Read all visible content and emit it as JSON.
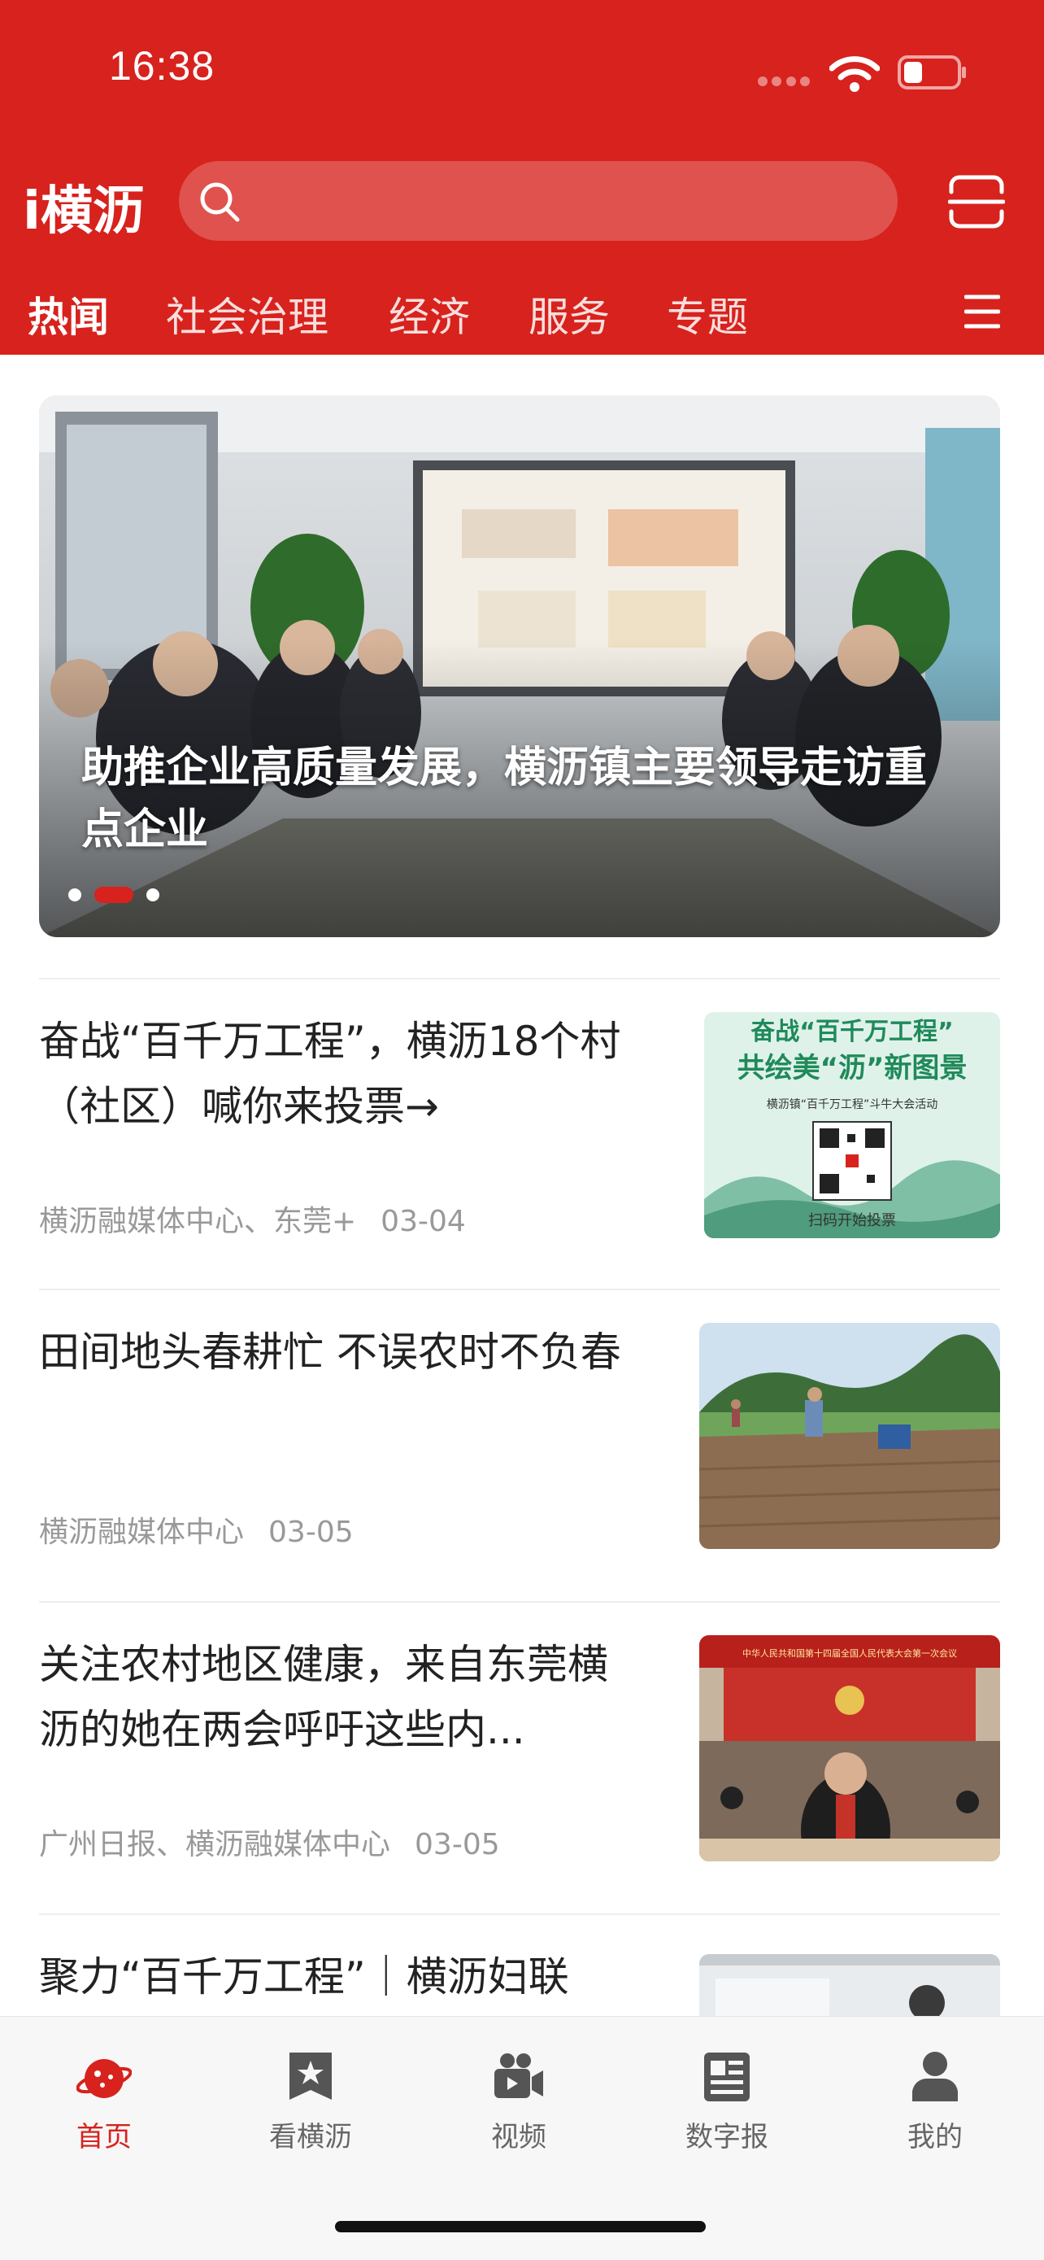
{
  "status_bar": {
    "time": "16:38"
  },
  "header": {
    "logo": "i横沥",
    "search": {
      "placeholder": ""
    },
    "tabs": [
      {
        "label": "热闻",
        "active": true
      },
      {
        "label": "社会治理",
        "active": false
      },
      {
        "label": "经济",
        "active": false
      },
      {
        "label": "服务",
        "active": false
      },
      {
        "label": "专题",
        "active": false
      }
    ]
  },
  "banner": {
    "title": "助推企业高质量发展，横沥镇主要领导走访重点企业",
    "pager": {
      "count": 3,
      "active_index": 1
    }
  },
  "news": [
    {
      "title": "奋战“百千万工程”，横沥18个村（社区）喊你来投票→",
      "source": "横沥融媒体中心、东莞+",
      "date": "03-04",
      "thumb_text": {
        "line1": "奋战“百千万工程”",
        "line2": "共绘美“沥”新图景",
        "line3": "横沥镇“百千万工程”斗牛大会活动",
        "line4": "扫码开始投票"
      }
    },
    {
      "title": "田间地头春耕忙 不误农时不负春",
      "source": "横沥融媒体中心",
      "date": "03-05"
    },
    {
      "title": "关注农村地区健康，来自东莞横沥的她在两会呼吁这些内...",
      "source": "广州日报、横沥融媒体中心",
      "date": "03-05",
      "thumb_text": {
        "banner": "中华人民共和国第十四届全国人民代表大会第一次会议"
      }
    },
    {
      "title": "聚力“百千万工程”｜横沥妇联"
    }
  ],
  "bottom_nav": [
    {
      "label": "首页",
      "icon": "home-planet-icon",
      "active": true
    },
    {
      "label": "看横沥",
      "icon": "bookmark-star-icon",
      "active": false
    },
    {
      "label": "视频",
      "icon": "video-camera-icon",
      "active": false
    },
    {
      "label": "数字报",
      "icon": "newspaper-icon",
      "active": false
    },
    {
      "label": "我的",
      "icon": "user-icon",
      "active": false
    }
  ],
  "colors": {
    "brand_red": "#d7221d",
    "text_dark": "#222222",
    "text_meta": "#999999"
  }
}
